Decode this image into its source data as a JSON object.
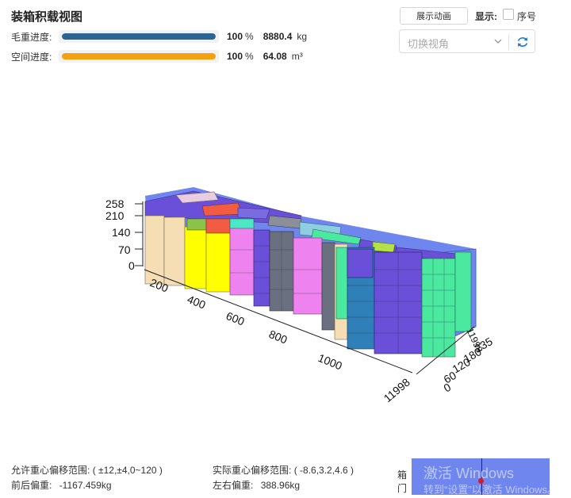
{
  "header": {
    "title": "装箱积载视图"
  },
  "progress": [
    {
      "label": "毛重进度:",
      "percent": 100,
      "percent_unit": "%",
      "value": "8880.4",
      "unit": "kg",
      "color": "#2a6596"
    },
    {
      "label": "空间进度:",
      "percent": 100,
      "percent_unit": "%",
      "value": "64.08",
      "unit": "m³",
      "color": "#f5a00f"
    }
  ],
  "toolbar": {
    "animate_label": "展示动画",
    "display_label": "显示:",
    "seq_checkbox_label": "序号",
    "seq_checked": false,
    "view_placeholder": "切换视角",
    "chevron_icon": "chevron-down-icon",
    "refresh_icon": "refresh-icon",
    "accent": "#1a7bd6"
  },
  "scene": {
    "y_ticks": [
      "258",
      "210",
      "140",
      "70",
      "0"
    ],
    "x_ticks": [
      "200",
      "400",
      "600",
      "800",
      "1000",
      "11998"
    ],
    "z_ticks": [
      "235",
      "180",
      "120",
      "60",
      "0"
    ],
    "length_label": "11998",
    "container_color": "#6f86ef"
  },
  "footer": {
    "allowed_cg_label": "允许重心偏移范围:",
    "allowed_cg_value": "( ±12,±4,0~120 )",
    "actual_cg_label": "实际重心偏移范围:",
    "actual_cg_value": "( -8.6,3.2,4.6 )",
    "front_back_label": "前后偏重:",
    "front_back_value": "-1167.459kg",
    "left_right_label": "左右偏重:",
    "left_right_value": "388.96kg",
    "door_label_1": "箱",
    "door_label_2": "门",
    "watermark_1": "激活 Windows",
    "watermark_2": "转到“设置”以激活 Windows。"
  }
}
